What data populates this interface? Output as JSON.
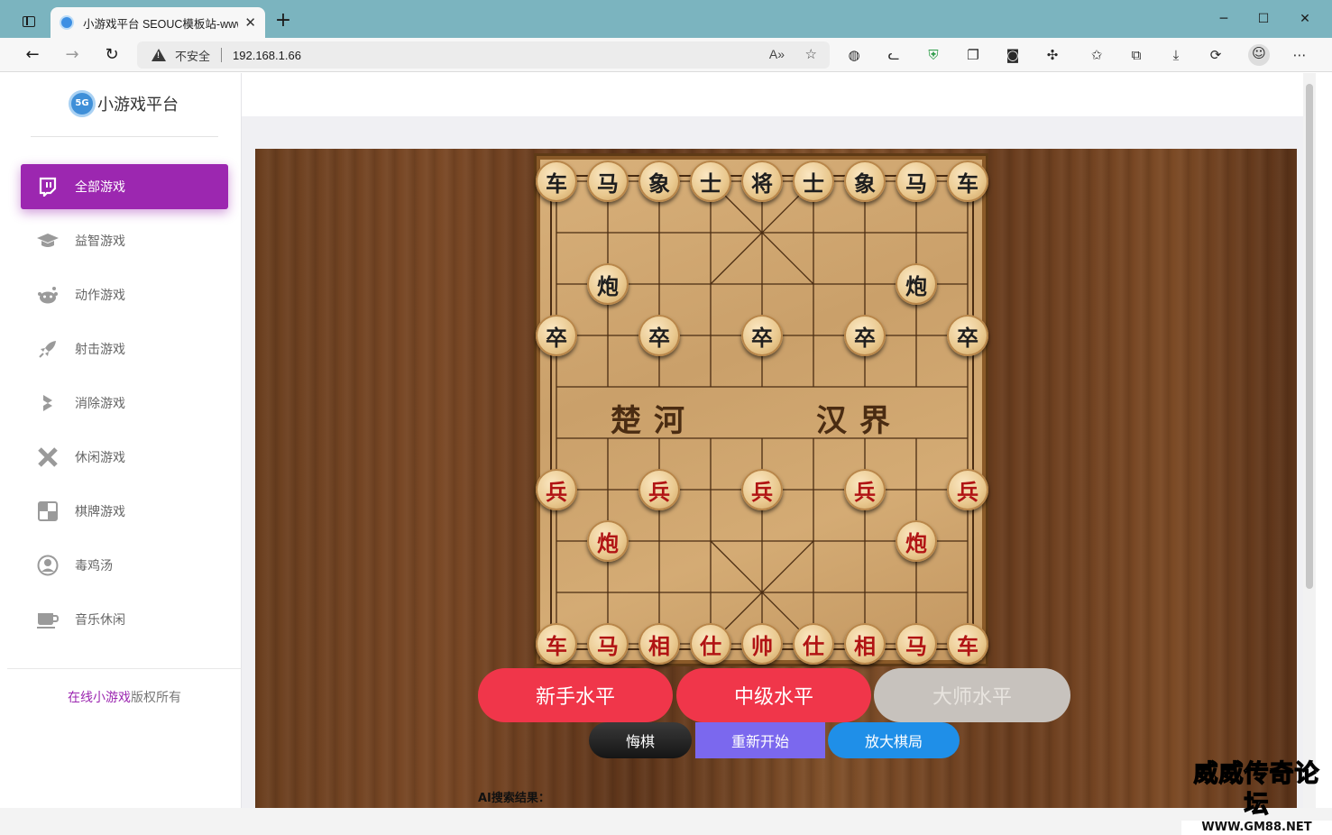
{
  "browser": {
    "tab_title": "小游戏平台 SEOUC模板站-www.s",
    "security_label": "不安全",
    "url": "192.168.1.66"
  },
  "sidebar": {
    "logo_mark": "5G",
    "logo_text": "小游戏平台",
    "items": [
      {
        "label": "全部游戏",
        "icon": "twitch-icon",
        "glyph": "▣",
        "active": true
      },
      {
        "label": "益智游戏",
        "icon": "graduation-cap-icon",
        "glyph": "🎓",
        "active": false
      },
      {
        "label": "动作游戏",
        "icon": "reddit-icon",
        "glyph": "☻",
        "active": false
      },
      {
        "label": "射击游戏",
        "icon": "rocket-icon",
        "glyph": "➶",
        "active": false
      },
      {
        "label": "消除游戏",
        "icon": "codepen-icon",
        "glyph": "◈",
        "active": false
      },
      {
        "label": "休闲游戏",
        "icon": "rebel-icon",
        "glyph": "✕",
        "active": false
      },
      {
        "label": "棋牌游戏",
        "icon": "chess-board-icon",
        "glyph": "▚",
        "active": false
      },
      {
        "label": "毒鸡汤",
        "icon": "user-circle-icon",
        "glyph": "◉",
        "active": false
      },
      {
        "label": "音乐休闲",
        "icon": "coffee-icon",
        "glyph": "☕",
        "active": false
      }
    ],
    "copyright_highlight": "在线小游戏",
    "copyright_rest": "版权所有"
  },
  "game": {
    "river_left": "楚河",
    "river_right": "汉界",
    "black_pieces": [
      "车",
      "马",
      "象",
      "士",
      "将",
      "士",
      "象",
      "马",
      "车",
      "炮",
      "炮",
      "卒",
      "卒",
      "卒",
      "卒",
      "卒"
    ],
    "red_pieces": [
      "兵",
      "兵",
      "兵",
      "兵",
      "兵",
      "炮",
      "炮",
      "车",
      "马",
      "相",
      "仕",
      "帅",
      "仕",
      "相",
      "马",
      "车"
    ],
    "levels": {
      "novice": "新手水平",
      "intermediate": "中级水平",
      "master": "大师水平"
    },
    "actions": {
      "undo": "悔棋",
      "restart": "重新开始",
      "zoom": "放大棋局"
    },
    "ai_result_label": "AI搜索结果："
  },
  "watermark": {
    "title": "威威传奇论坛",
    "url": "WWW.GM88.NET"
  }
}
